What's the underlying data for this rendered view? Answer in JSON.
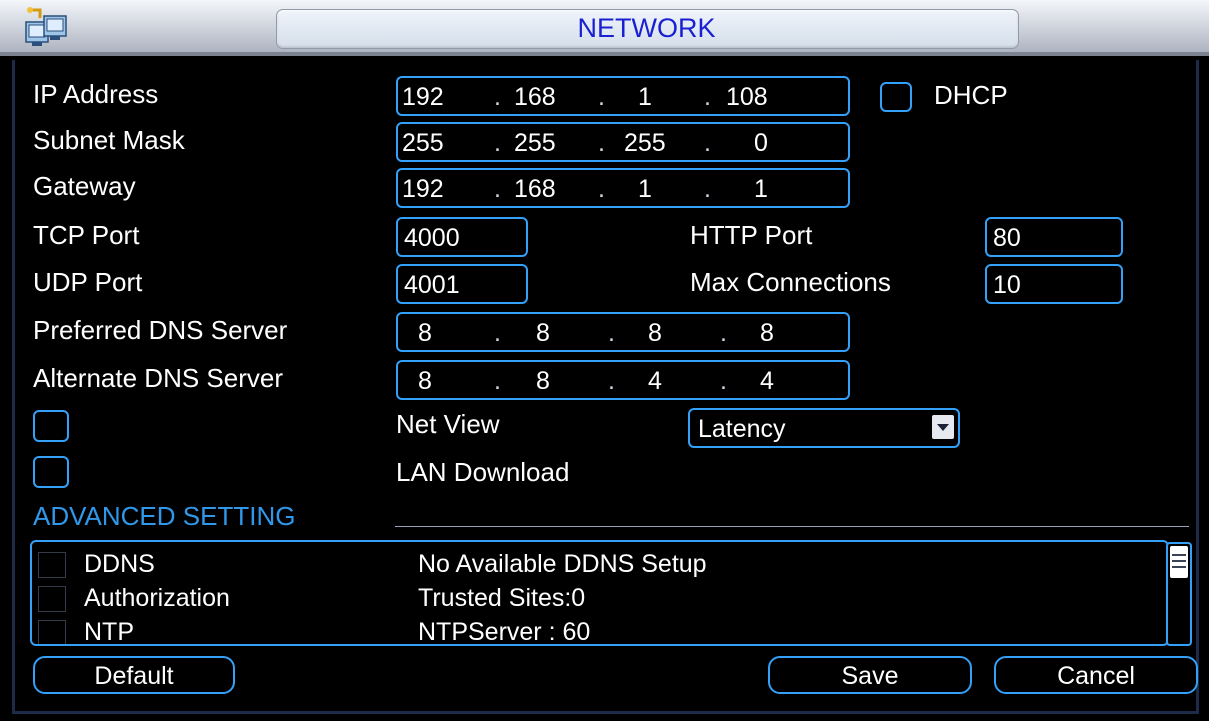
{
  "window": {
    "title": "NETWORK",
    "icon": "network-app-icon"
  },
  "form": {
    "ip_label": "IP Address",
    "ip": [
      "192",
      "168",
      "1",
      "108"
    ],
    "dhcp_label": "DHCP",
    "dhcp_checked": false,
    "subnet_label": "Subnet Mask",
    "subnet": [
      "255",
      "255",
      "255",
      "0"
    ],
    "gateway_label": "Gateway",
    "gateway": [
      "192",
      "168",
      "1",
      "1"
    ],
    "tcp_label": "TCP Port",
    "tcp_value": "4000",
    "http_label": "HTTP Port",
    "http_value": "80",
    "udp_label": "UDP Port",
    "udp_value": "4001",
    "maxconn_label": "Max Connections",
    "maxconn_value": "10",
    "dns1_label": "Preferred DNS Server",
    "dns1": [
      "8",
      "8",
      "8",
      "8"
    ],
    "dns2_label": "Alternate DNS Server",
    "dns2": [
      "8",
      "8",
      "4",
      "4"
    ],
    "netview_label": "Net View",
    "netview_checked": false,
    "netview_select": "Latency",
    "lan_label": "LAN Download",
    "lan_checked": false
  },
  "advanced": {
    "title": "ADVANCED SETTING",
    "rows": [
      {
        "name": "DDNS",
        "value": "No Available DDNS Setup"
      },
      {
        "name": "Authorization",
        "value": "Trusted Sites:0"
      },
      {
        "name": "NTP",
        "value": "NTPServer : 60"
      }
    ]
  },
  "buttons": {
    "default": "Default",
    "save": "Save",
    "cancel": "Cancel"
  },
  "colors": {
    "accent": "#35a0f7",
    "title_text": "#1a1fd1",
    "section_title": "#2f98ea"
  }
}
